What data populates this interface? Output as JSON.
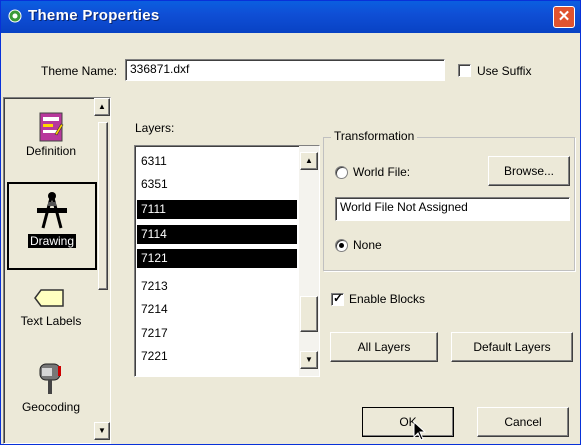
{
  "window": {
    "title": "Theme Properties",
    "close_glyph": "✕"
  },
  "theme_name": {
    "label": "Theme Name:",
    "value": "336871.dxf"
  },
  "use_suffix": {
    "label": "Use Suffix",
    "checked": false
  },
  "categories": [
    {
      "label": "Definition",
      "icon": "definition-icon",
      "selected": false
    },
    {
      "label": "Drawing",
      "icon": "drawing-icon",
      "selected": true
    },
    {
      "label": "Text Labels",
      "icon": "text-labels-icon",
      "selected": false
    },
    {
      "label": "Geocoding",
      "icon": "geocoding-icon",
      "selected": false
    }
  ],
  "layers": {
    "label": "Layers:",
    "items": [
      {
        "name": "6311",
        "selected": false
      },
      {
        "name": "6351",
        "selected": false
      },
      {
        "name": "7111",
        "selected": true
      },
      {
        "name": "7114",
        "selected": true
      },
      {
        "name": "7121",
        "selected": true
      },
      {
        "name": "7213",
        "selected": false
      },
      {
        "name": "7214",
        "selected": false
      },
      {
        "name": "7217",
        "selected": false
      },
      {
        "name": "7221",
        "selected": false
      }
    ]
  },
  "transformation": {
    "label": "Transformation",
    "world_file_label": "World File:",
    "browse_label": "Browse...",
    "world_file_value": "World File Not Assigned",
    "none_label": "None",
    "selected": "None"
  },
  "enable_blocks": {
    "label": "Enable Blocks",
    "checked": true
  },
  "buttons": {
    "all_layers": "All Layers",
    "default_layers": "Default Layers",
    "ok": "OK",
    "cancel": "Cancel"
  },
  "colors": {
    "titlebar": "#0a5fe0",
    "dialog_bg": "#ece9d8",
    "selection": "#000000",
    "close": "#e0532f"
  }
}
